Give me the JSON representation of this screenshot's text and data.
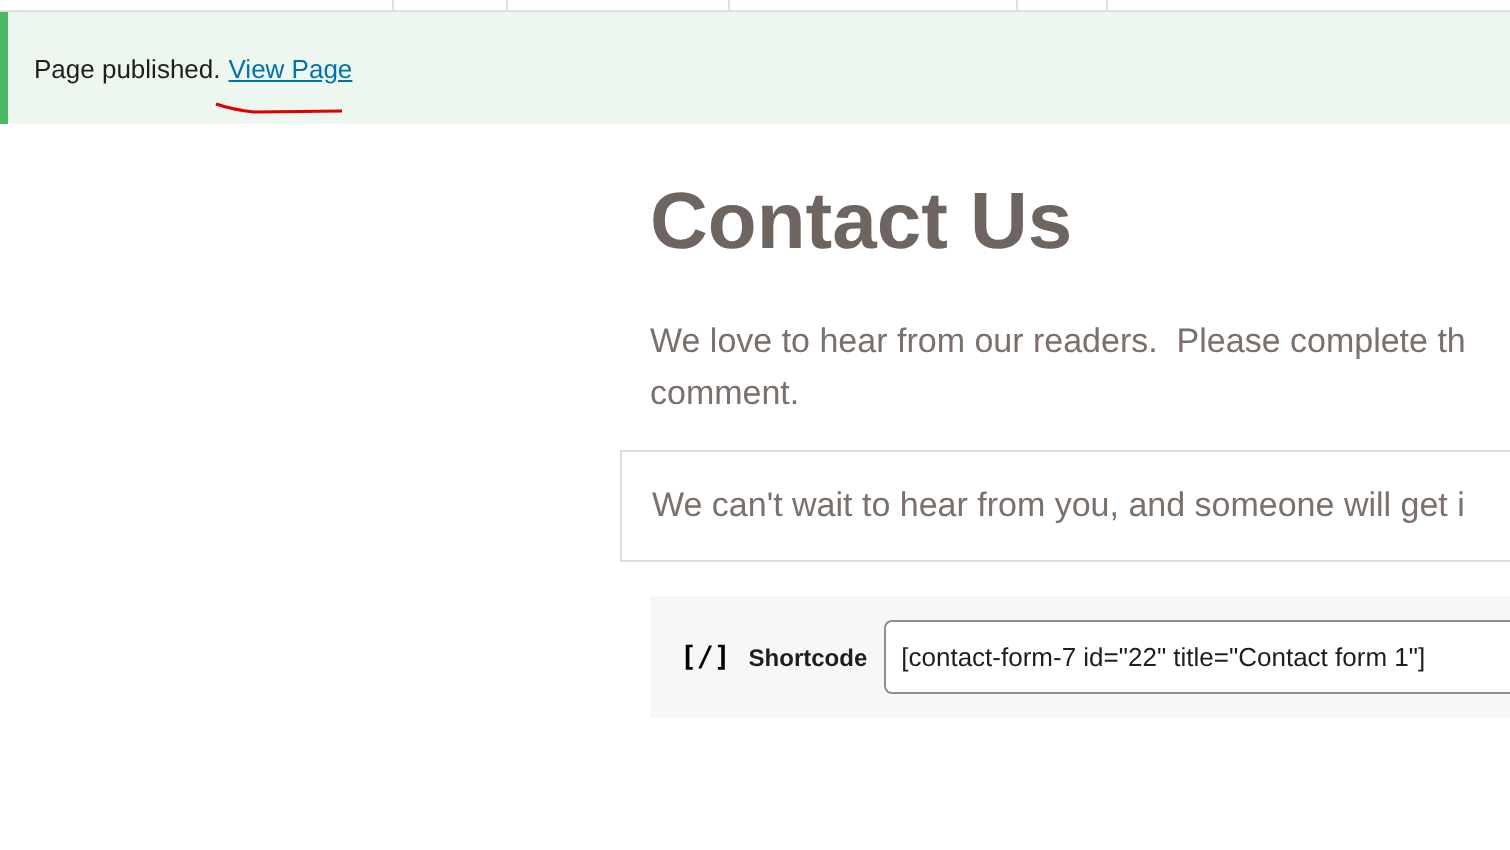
{
  "notice": {
    "message": "Page published.",
    "link": "View Page"
  },
  "content": {
    "heading": "Contact Us",
    "paragraph": "We love to hear from our readers.  Please complete th\ncomment.",
    "quote": "We can't wait to hear from you, and someone will get i",
    "shortcode": {
      "label": "Shortcode",
      "icon": "[/]",
      "value": "[contact-form-7 id=\"22\" title=\"Contact form 1\"]"
    }
  }
}
